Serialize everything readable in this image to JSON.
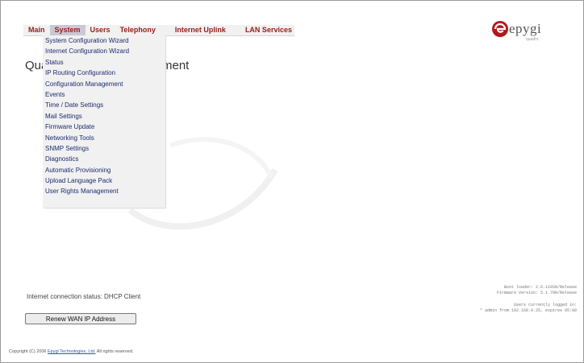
{
  "menu": {
    "items": [
      {
        "label": "Main"
      },
      {
        "label": "System"
      },
      {
        "label": "Users"
      },
      {
        "label": "Telephony"
      },
      {
        "label": "Internet Uplink"
      },
      {
        "label": "LAN Services"
      }
    ]
  },
  "logo": {
    "word": "epygi",
    "sub": "quadro"
  },
  "page": {
    "title_left": "Qua",
    "title_right": "ment"
  },
  "system_menu": {
    "items": [
      "System Configuration Wizard",
      "Internet Configuration Wizard",
      "Status",
      "IP Routing Configuration",
      "Configuration Management",
      "Events",
      "Time / Date Settings",
      "Mail Settings",
      "Firmware Update",
      "Networking Tools",
      "SNMP Settings",
      "Diagnostics",
      "Automatic Provisioning",
      "Upload Language Pack",
      "User Rights Management"
    ]
  },
  "status": {
    "connection": "Internet connection status: DHCP Client",
    "renew_label": "Renew WAN IP Address"
  },
  "info": {
    "boot_loader": "Boot loader: 2.6.110SN/Release",
    "firmware": "Firmware Version: 5.1.79N/Release",
    "users_logged": "Users currently logged in:",
    "admin_session": "* admin from 192.168.0.25, expires 05:00"
  },
  "footer": {
    "prefix": "Copyright (C) 2006",
    "company": "Epygi Technologies, Ltd.",
    "suffix": "All rights reserved."
  }
}
